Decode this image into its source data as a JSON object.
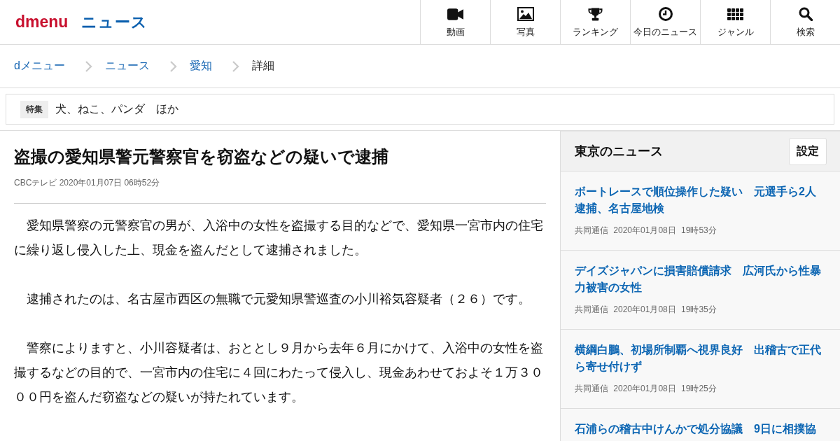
{
  "header": {
    "logo": "dmenu",
    "section": "ニュース",
    "nav": [
      {
        "kind": "video",
        "label": "動画"
      },
      {
        "kind": "photo",
        "label": "写真"
      },
      {
        "kind": "ranking",
        "label": "ランキング"
      },
      {
        "kind": "clock",
        "label": "今日のニュース"
      },
      {
        "kind": "genre",
        "label": "ジャンル"
      },
      {
        "kind": "search",
        "label": "検索"
      }
    ]
  },
  "breadcrumb": [
    {
      "label": "dメニュー",
      "current": false
    },
    {
      "label": "ニュース",
      "current": false
    },
    {
      "label": "愛知",
      "current": false
    },
    {
      "label": "詳細",
      "current": true
    }
  ],
  "feature": {
    "badge": "特集",
    "text": "犬、ねこ、パンダ　ほか"
  },
  "article": {
    "title": "盗撮の愛知県警元警察官を窃盗などの疑いで逮捕",
    "meta": "CBCテレビ 2020年01月07日 06時52分",
    "paragraphs": [
      "　愛知県警察の元警察官の男が、入浴中の女性を盗撮する目的などで、愛知県一宮市内の住宅に繰り返し侵入した上、現金を盗んだとして逮捕されました。",
      "　逮捕されたのは、名古屋市西区の無職で元愛知県警巡査の小川裕気容疑者（２６）です。",
      "　警察によりますと、小川容疑者は、おととし９月から去年６月にかけて、入浴中の女性を盗撮するなどの目的で、一宮市内の住宅に４回にわたって侵入し、現金あわせておよそ１万３０００円を盗んだ窃盗などの疑いが持たれています。"
    ]
  },
  "sidebar": {
    "title": "東京のニュース",
    "button": "設定",
    "items": [
      {
        "title": "ボートレースで順位操作した疑い　元選手ら2人逮捕、名古屋地検",
        "meta": "共同通信 2020年01月08日 19時53分"
      },
      {
        "title": "デイズジャパンに損害賠償請求　広河氏から性暴力被害の女性",
        "meta": "共同通信 2020年01月08日 19時35分"
      },
      {
        "title": "横綱白鵬、初場所制覇へ視界良好　出稽古で正代ら寄せ付けず",
        "meta": "共同通信 2020年01月08日 19時25分"
      },
      {
        "title": "石浦らの稽古中けんかで処分協議　9日に相撲協"
      }
    ]
  }
}
